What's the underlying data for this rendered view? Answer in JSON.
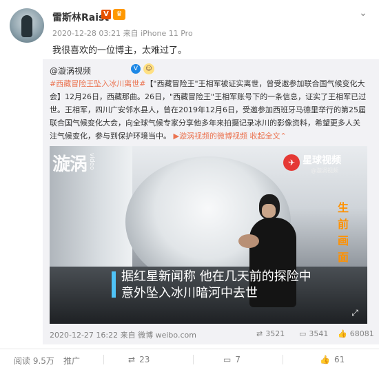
{
  "post": {
    "author": "雷斯林Raist",
    "vip_label": "V",
    "meta": "2020-12-28 03:21 来自 iPhone 11 Pro",
    "text": "我很喜欢的一位博主，太难过了。"
  },
  "repost": {
    "author": "@漩涡视频",
    "verified_label": "V",
    "body_lines": [
      {
        "hashtag": "#西藏冒险王坠入冰川离世#",
        "text": "【\"西藏冒险王\"王相军被证实离世，曾受邀参加联合国气候变化大"
      },
      {
        "hashtag": "",
        "text": "会】12月26日，西藏那曲。26日，\"西藏冒险王\"王相军账号下的一条信息，证实了王相军已过"
      },
      {
        "hashtag": "",
        "text": "世。王相军，四川广安邻水县人，曾在2019年12月6日，受邀参加西班牙马德里举行的第25届"
      },
      {
        "hashtag": "",
        "text": "联合国气候变化大会，向全球气候专家分享他多年来拍摄记录冰川的影像资料，希望更多人关"
      },
      {
        "hashtag": "",
        "text": "注气候变化，参与到保护环境当中。"
      }
    ],
    "video_link": "漩涡视频的微博视频",
    "expand_label": "收起全文",
    "date": "2020-12-27 16:22 来自 微博 weibo.com",
    "reposts": "3521",
    "comments": "3541",
    "likes": "68081"
  },
  "video": {
    "watermark_left": "漩涡",
    "watermark_left_sub": "video",
    "logo_name": "星球视频",
    "logo_sub": "@漩涡视频",
    "side_label": "生前画面",
    "subtitle_lines": [
      "据红星新闻称 他在几天前的探险中",
      "意外坠入冰川暗河中去世"
    ]
  },
  "actions": {
    "views": "阅读 9.5万",
    "promote": "推广",
    "reposts": "23",
    "comments": "7",
    "likes": "61"
  },
  "colors": {
    "accent": "#eb7350",
    "subtitle_bar": "#4fc3f7",
    "side_label": "#ff9100",
    "verified": "#1e88e5"
  },
  "icons": [
    "chevron-down-icon",
    "vip-icon",
    "crown-icon",
    "verified-icon",
    "fullscreen-icon",
    "repost-icon",
    "comment-icon",
    "like-icon"
  ]
}
